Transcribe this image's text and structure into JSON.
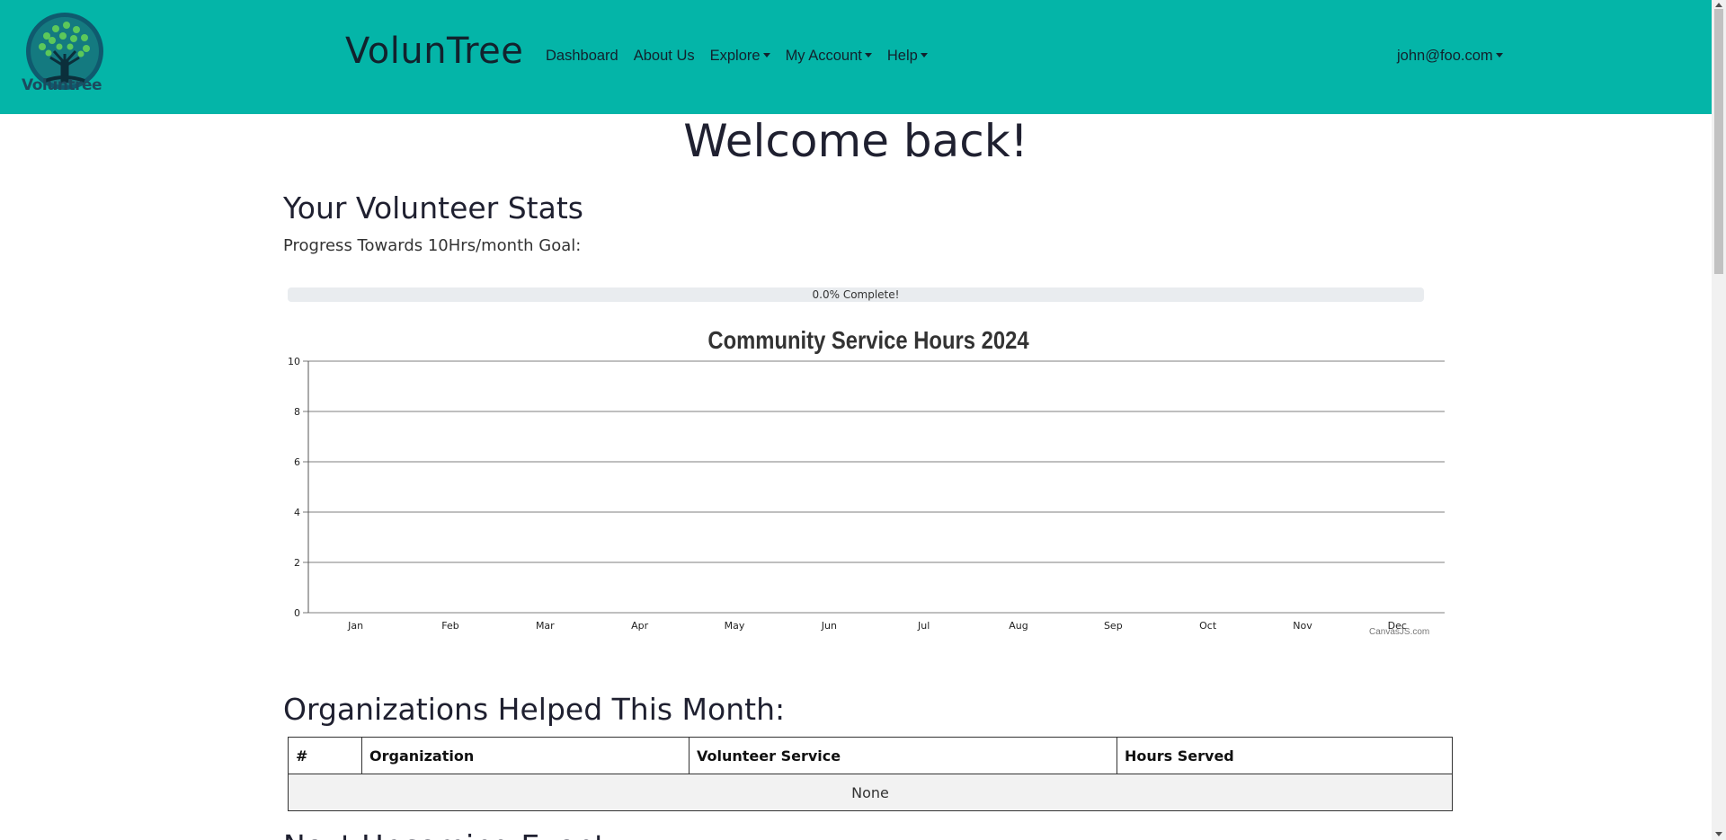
{
  "nav": {
    "logo_text": "Voluntree",
    "brand": "VolunTree",
    "links": [
      {
        "label": "Dashboard",
        "dropdown": false
      },
      {
        "label": "About Us",
        "dropdown": false
      },
      {
        "label": "Explore",
        "dropdown": true
      },
      {
        "label": "My Account",
        "dropdown": true
      },
      {
        "label": "Help",
        "dropdown": true
      }
    ],
    "account": "john@foo.com"
  },
  "colors": {
    "accent": "#04b5a8",
    "text_dark": "#12222d",
    "logo_leaf": "#4caf50",
    "logo_trunk": "#1c4a5e"
  },
  "welcome": "Welcome back!",
  "stats": {
    "title": "Your Volunteer Stats",
    "progress_label": "Progress Towards 10Hrs/month Goal:",
    "progress_value": 0.0,
    "progress_text": "0.0% Complete!"
  },
  "chart_data": {
    "type": "bar",
    "title": "Community Service Hours 2024",
    "categories": [
      "Jan",
      "Feb",
      "Mar",
      "Apr",
      "May",
      "Jun",
      "Jul",
      "Aug",
      "Sep",
      "Oct",
      "Nov",
      "Dec"
    ],
    "values": [
      0,
      0,
      0,
      0,
      0,
      0,
      0,
      0,
      0,
      0,
      0,
      0
    ],
    "ylim": [
      0,
      10
    ],
    "yticks": [
      0,
      2,
      4,
      6,
      8,
      10
    ],
    "grid": true,
    "credit": "CanvasJS.com"
  },
  "orgs": {
    "title": "Organizations Helped This Month:",
    "columns": [
      "#",
      "Organization",
      "Volunteer Service",
      "Hours Served"
    ],
    "empty_text": "None"
  },
  "next_title": "Next Upcoming Event"
}
